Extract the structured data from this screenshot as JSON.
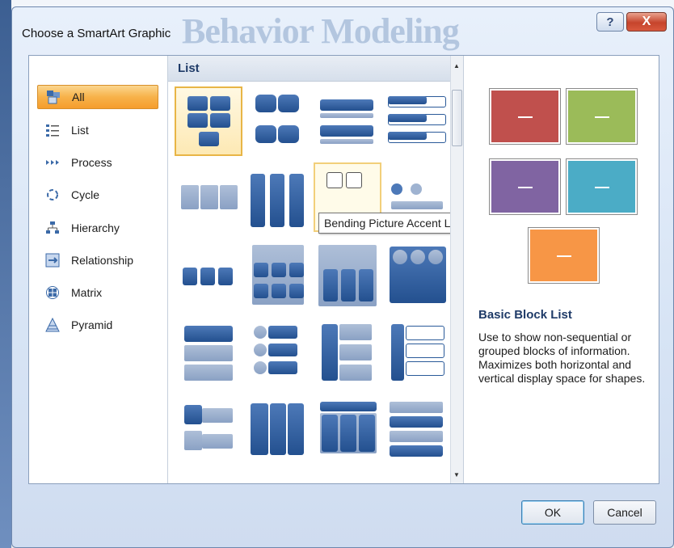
{
  "window": {
    "title": "Choose a SmartArt Graphic",
    "background_text": "Behavior Modeling",
    "help_label": "?",
    "close_label": "X"
  },
  "categories": [
    {
      "label": "All",
      "icon": "all-icon",
      "selected": true
    },
    {
      "label": "List",
      "icon": "list-icon"
    },
    {
      "label": "Process",
      "icon": "process-icon"
    },
    {
      "label": "Cycle",
      "icon": "cycle-icon"
    },
    {
      "label": "Hierarchy",
      "icon": "hierarchy-icon"
    },
    {
      "label": "Relationship",
      "icon": "relationship-icon"
    },
    {
      "label": "Matrix",
      "icon": "matrix-icon"
    },
    {
      "label": "Pyramid",
      "icon": "pyramid-icon"
    }
  ],
  "gallery": {
    "header": "List",
    "tooltip": "Bending Picture Accent List",
    "selected_index": 0,
    "hover_index": 6
  },
  "preview": {
    "title": "Basic Block List",
    "description": "Use to show non-sequential or grouped blocks of information. Maximizes both horizontal and vertical display space for shapes.",
    "block_label": "–",
    "colors": [
      "#c0504d",
      "#9bbb59",
      "#8064a2",
      "#4bacc6",
      "#f79646"
    ]
  },
  "buttons": {
    "ok": "OK",
    "cancel": "Cancel"
  }
}
